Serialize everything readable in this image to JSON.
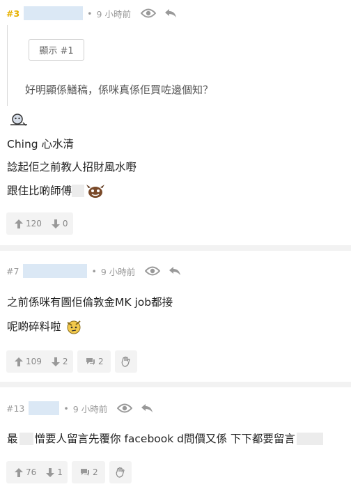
{
  "posts": [
    {
      "floor": "#3",
      "time": "9 小時前",
      "quote_button": "顯示 #1",
      "quote_text": "好明顯係鱔稿，係咪真係佢買咗邊個知？",
      "lines": [
        "Ching 心水清",
        "諗起佢之前教人招財風水嘢",
        "跟住比啲師傅"
      ],
      "upvotes": "120",
      "downvotes": "0"
    },
    {
      "floor": "#7",
      "time": "9 小時前",
      "lines": [
        "之前係咪有圖佢倫敦金MK job都接",
        "呢啲碎料啦"
      ],
      "upvotes": "109",
      "downvotes": "2",
      "replies": "2"
    },
    {
      "floor": "#13",
      "time": "9 小時前",
      "line_parts": [
        "最",
        "憎要人留言先覆你 facebook d問價又係 下下都要留言"
      ],
      "upvotes": "76",
      "downvotes": "1",
      "replies": "2"
    }
  ],
  "icons": [
    "eye-icon",
    "reply-icon",
    "upvote-icon",
    "downvote-icon",
    "comment-icon",
    "hand-wave-icon"
  ],
  "colors": {
    "floor_highlight": "#e7b100",
    "username_mask": "#dbe8f5",
    "separator": "#f2f2f2",
    "button_bg": "#f3f3f3"
  }
}
